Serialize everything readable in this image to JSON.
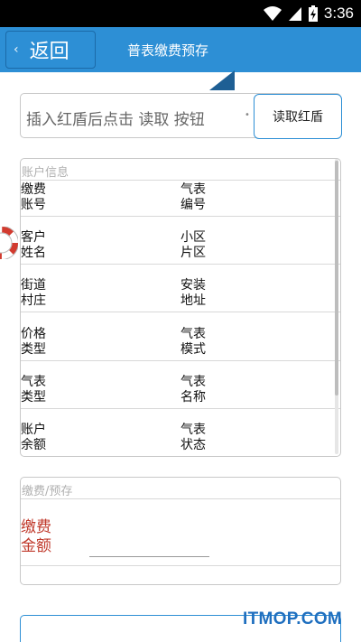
{
  "status_bar": {
    "time": "3:36"
  },
  "header": {
    "back_label": "返回",
    "title": "普表缴费预存"
  },
  "read_card": {
    "hint": "插入红盾后点击 读取 按钮",
    "button_label": "读取红盾"
  },
  "account_info": {
    "title": "账户信息",
    "rows": [
      {
        "left_top": "缴费",
        "left_bottom": "账号",
        "right_top": "气表",
        "right_bottom": "编号"
      },
      {
        "left_top": "客户",
        "left_bottom": "姓名",
        "right_top": "小区",
        "right_bottom": "片区"
      },
      {
        "left_top": "街道",
        "left_bottom": "村庄",
        "right_top": "安装",
        "right_bottom": "地址"
      },
      {
        "left_top": "价格",
        "left_bottom": "类型",
        "right_top": "气表",
        "right_bottom": "模式"
      },
      {
        "left_top": "气表",
        "left_bottom": "类型",
        "right_top": "气表",
        "right_bottom": "名称"
      },
      {
        "left_top": "账户",
        "left_bottom": "余额",
        "right_top": "气表",
        "right_bottom": "状态"
      }
    ]
  },
  "payment": {
    "title": "缴费/预存",
    "label_top": "缴费",
    "label_bottom": "金额",
    "amount_value": ""
  },
  "watermark": "ITMOP.COM",
  "colors": {
    "accent": "#2d8fd5",
    "pay_label": "#c0392b"
  }
}
